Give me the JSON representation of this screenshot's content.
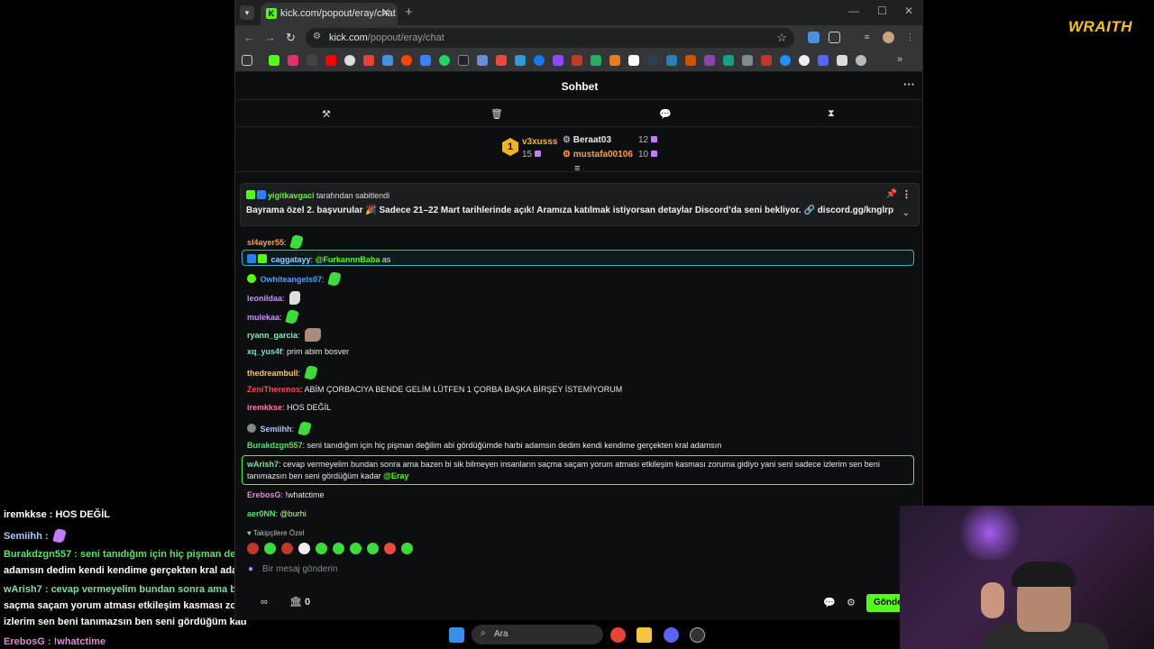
{
  "browser": {
    "tab_title": "kick.com/popout/eray/chat",
    "url_domain": "kick.com",
    "url_path": "/popout/eray/chat"
  },
  "chat": {
    "title": "Sohbet",
    "leaderboard": {
      "first": {
        "rank": "1",
        "name": "v3xusss",
        "count": "15"
      },
      "second": {
        "name": "Beraat03",
        "count": "12"
      },
      "third": {
        "name": "mustafa00106",
        "count": "10"
      }
    },
    "pinned": {
      "by_user": "yigitkavgaci",
      "by_suffix": "tarafından sabitlendi",
      "text": "Bayrama özel 2. başvurular 🎉 Sadece 21–22 Mart tarihlerinde açık! Aramıza katılmak istiyorsan detaylar Discord’da seni bekliyor. 🔗 discord.gg/knglrp"
    },
    "messages": [
      {
        "user": "sl4ayer55",
        "text": ""
      },
      {
        "user": "caggatayy",
        "text": "as",
        "mention": "@FurkannnBaba"
      },
      {
        "user": "Owhiteangels07",
        "text": ""
      },
      {
        "user": "leonildaa",
        "text": ""
      },
      {
        "user": "mulekaa",
        "text": ""
      },
      {
        "user": "ryann_garcia",
        "text": ""
      },
      {
        "user": "xq_yus4f",
        "text": "prim abim bosver"
      },
      {
        "user": "thedreambull",
        "text": ""
      },
      {
        "user": "ZeniTherenos",
        "text": "ABİM ÇORBACIYA BENDE GELİM LÜTFEN 1 ÇORBA BAŞKA BİRŞEY İSTEMİYORUM"
      },
      {
        "user": "iremkkse",
        "text": "HOS DEĞİL"
      },
      {
        "user": "Semiihh",
        "text": ""
      },
      {
        "user": "Burakdzgn557",
        "text": "seni tanıdığım için hiç pişman değilim abi gördüğümde harbi adamsın dedim kendi kendime gerçekten kral adamsın"
      },
      {
        "user": "wArish7",
        "text": "cevap vermeyelim bundan sonra ama bazen bi sik bilmeyen insanların saçma saçam yorum atması etkileşim kasması zoruma gidiyo yani seni sadece izlerim sen beni",
        "text2": "tanımazsın ben seni gördüğüm kadar",
        "mention": "@Eray"
      },
      {
        "user": "ErebosG",
        "text": "!whatctime"
      },
      {
        "user": "aer0NN",
        "text": "",
        "mention": "@burhi"
      }
    ],
    "followers_label": "Takipçilere Özel",
    "input_placeholder": "Bir mesaj gönderin",
    "points": "0",
    "send_label": "Gönder"
  },
  "overlay": {
    "lines": [
      "iremkkse : HOS DEĞİL",
      "Semiihh :",
      "Burakdzgn557 : seni tanıdığım için hiç pişman deği",
      "adamsın dedim kendi kendime gerçekten kral adam",
      "wArish7 : cevap vermeyelim bundan sonra ama baz",
      "saçma saçam yorum atması etkileşim kasması zor",
      "izlerim sen beni tanımazsın ben seni gördüğüm kad",
      "ErebosG : !whatctime"
    ],
    "brand": "WRAITH"
  },
  "taskbar": {
    "search_label": "Ara"
  },
  "colors": {
    "kick_green": "#53fc18",
    "gift_purple": "#c57bff",
    "wraith_yellow": "#f6c417"
  }
}
